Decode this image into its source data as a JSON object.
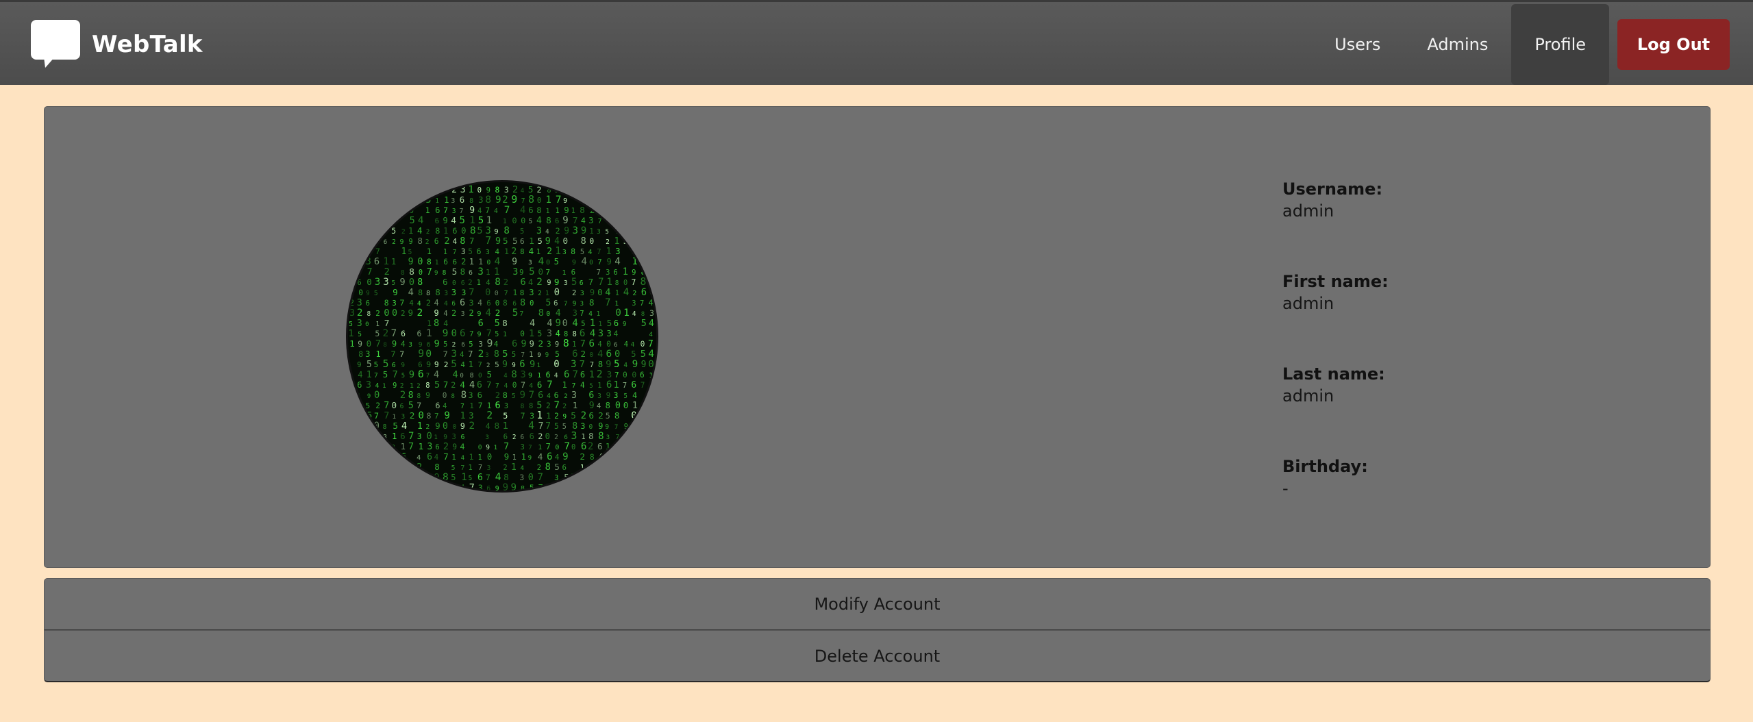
{
  "brand": {
    "name": "WebTalk",
    "icon": "chat-bubble-icon"
  },
  "nav": {
    "links": [
      {
        "label": "Users"
      },
      {
        "label": "Admins"
      },
      {
        "label": "Profile",
        "active": true
      }
    ],
    "logout_label": "Log Out"
  },
  "profile": {
    "avatar_alt": "profile-picture",
    "fields": [
      {
        "label": "Username:",
        "value": "admin"
      },
      {
        "label": "First name:",
        "value": "admin"
      },
      {
        "label": "Last name:",
        "value": "admin"
      },
      {
        "label": "Birthday:",
        "value": "-"
      }
    ]
  },
  "actions": {
    "modify_label": "Modify Account",
    "delete_label": "Delete Account"
  },
  "colors": {
    "page_background": "#fee3c1",
    "navbar": "#505050",
    "card": "#707070",
    "logout": "#8b2424",
    "matrix_green": "#5ee05a"
  }
}
